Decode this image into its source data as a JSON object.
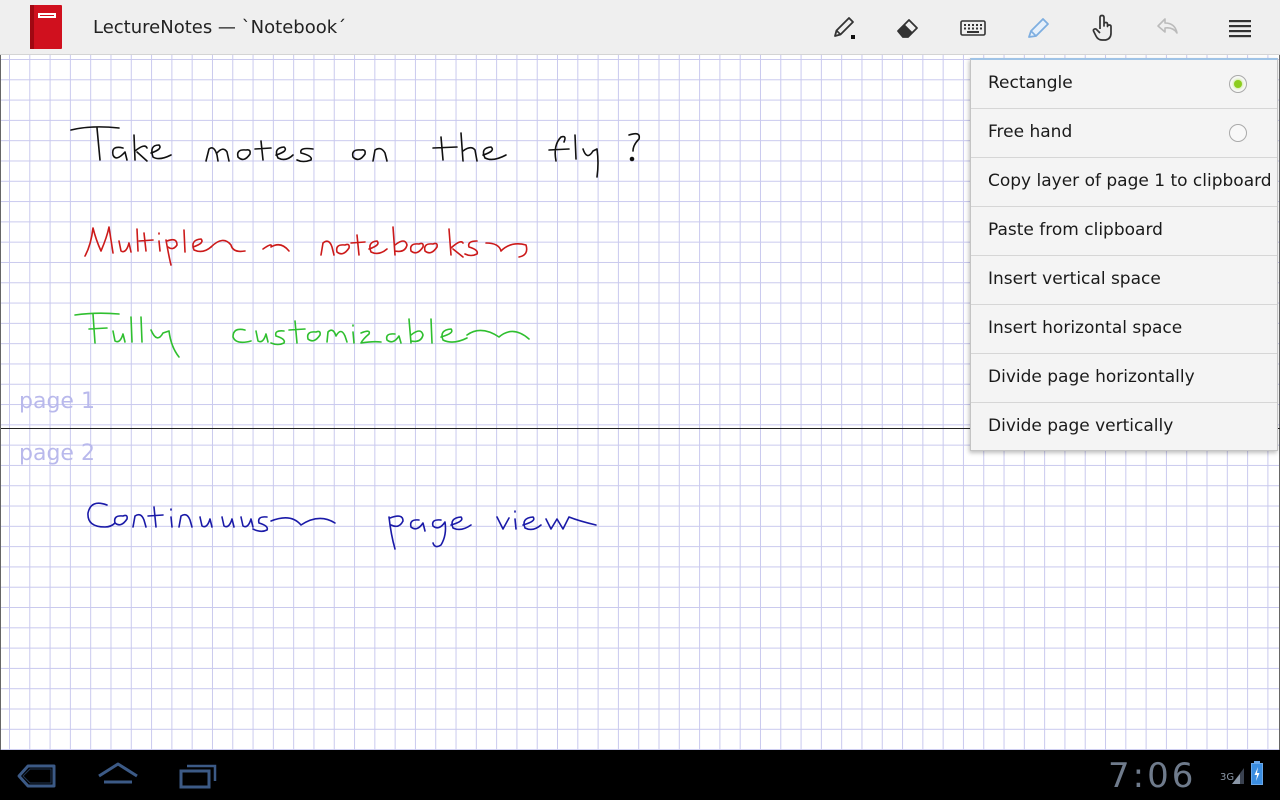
{
  "app": {
    "title": "LectureNotes — `Notebook´"
  },
  "toolbar": {
    "buttons": [
      {
        "name": "pen-tool",
        "icon": "pen-icon"
      },
      {
        "name": "eraser-tool",
        "icon": "eraser-icon"
      },
      {
        "name": "keyboard-tool",
        "icon": "keyboard-icon"
      },
      {
        "name": "selection-tool",
        "icon": "highlighter-icon",
        "active": true
      },
      {
        "name": "hand-tool",
        "icon": "hand-pointer-icon"
      },
      {
        "name": "undo",
        "icon": "undo-icon",
        "enabled": false
      },
      {
        "name": "overflow-menu",
        "icon": "menu-icon"
      }
    ]
  },
  "pages": {
    "page1_label": "page 1",
    "page2_label": "page 2"
  },
  "ink_notes": [
    {
      "text": "Take notes on the fly!",
      "color": "#111111"
    },
    {
      "text": "Multiple notebooks",
      "color": "#cc1a1a"
    },
    {
      "text": "Fully customizable",
      "color": "#2fbf2f"
    },
    {
      "text": "Continuous page view",
      "color": "#1a1aa8"
    }
  ],
  "menu": {
    "items": [
      {
        "label": "Rectangle",
        "radio": true,
        "selected": true
      },
      {
        "label": "Free hand",
        "radio": true,
        "selected": false
      },
      {
        "label": "Copy layer of page 1 to clipboard"
      },
      {
        "label": "Paste from clipboard"
      },
      {
        "label": "Insert vertical space"
      },
      {
        "label": "Insert horizontal space"
      },
      {
        "label": "Divide page horizontally"
      },
      {
        "label": "Divide page vertically"
      }
    ]
  },
  "system_bar": {
    "clock": "7:06",
    "network": "3G"
  },
  "colors": {
    "grid": "#c9c9ee",
    "radio_selected": "#8ccd1e",
    "app_icon_red": "#d0101e"
  }
}
